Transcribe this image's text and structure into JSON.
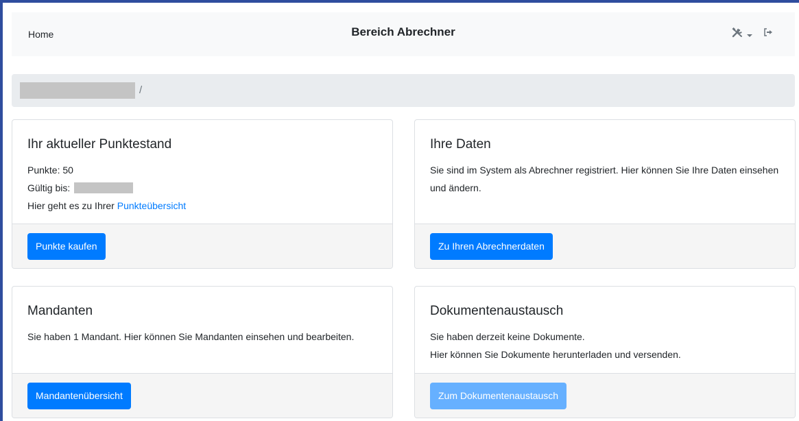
{
  "navbar": {
    "home_label": "Home",
    "title": "Bereich Abrechner",
    "tools_icon": "tools-icon",
    "logout_icon": "sign-out-icon"
  },
  "breadcrumb": {
    "separator": "/"
  },
  "cards": {
    "points": {
      "title": "Ihr aktueller Punktestand",
      "points_line": "Punkte: 50",
      "valid_label": "Gültig bis:",
      "overview_text": "Hier geht es zu Ihrer ",
      "overview_link": "Punkteübersicht",
      "button": "Punkte kaufen"
    },
    "data": {
      "title": "Ihre Daten",
      "text": "Sie sind im System als Abrechner registriert. Hier können Sie Ihre Daten einsehen und ändern.",
      "button": "Zu Ihren Abrechnerdaten"
    },
    "clients": {
      "title": "Mandanten",
      "text": "Sie haben 1 Mandant. Hier können Sie Mandanten einsehen und bearbeiten.",
      "button": "Mandantenübersicht"
    },
    "documents": {
      "title": "Dokumentenaustausch",
      "line1": "Sie haben derzeit keine Dokumente.",
      "line2": "Hier können Sie Dokumente herunterladen und versenden.",
      "button": "Zum Dokumentenaustausch"
    }
  },
  "colors": {
    "primary": "#007bff",
    "primary_disabled": "#66b0ff",
    "frame": "#2f4d9e"
  }
}
